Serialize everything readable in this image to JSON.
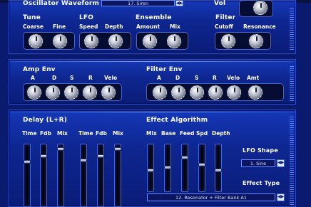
{
  "oscillator": {
    "title": "Oscillator Waveform",
    "waveform_value": "17. Siren",
    "tune": {
      "title": "Tune",
      "labels": [
        "Coarse",
        "Fine"
      ]
    },
    "lfo": {
      "title": "LFO",
      "labels": [
        "Speed",
        "Depth"
      ]
    },
    "ensemble": {
      "title": "Ensemble",
      "labels": [
        "Amount",
        "Mix"
      ]
    },
    "vol": {
      "title": "Vol"
    },
    "filter": {
      "title": "Filter",
      "labels": [
        "Cutoff",
        "Resonance"
      ]
    }
  },
  "amp_env": {
    "title": "Amp Env",
    "labels": [
      "A",
      "D",
      "S",
      "R",
      "Velo"
    ]
  },
  "filter_env": {
    "title": "Filter Env",
    "labels": [
      "A",
      "D",
      "S",
      "R",
      "Velo",
      "Amt"
    ]
  },
  "delay": {
    "title": "Delay (L+R)",
    "labels_left": [
      "Time",
      "Fdb",
      "Mix"
    ],
    "labels_right": [
      "Time",
      "Fdb",
      "Mix"
    ]
  },
  "effect": {
    "title": "Effect Algorithm",
    "labels": [
      "Mix",
      "Base",
      "Feed",
      "Spd",
      "Depth"
    ],
    "lfo_shape_title": "LFO Shape",
    "lfo_shape_value": "1. Sine",
    "effect_type_title": "Effect Type",
    "effect_type_value": "12. Resonator + Filter Bank A1"
  },
  "colors": {
    "panel": "#0e2690",
    "background": "#0a1a6e",
    "text": "#ffffff",
    "accent": "#4068e0"
  }
}
